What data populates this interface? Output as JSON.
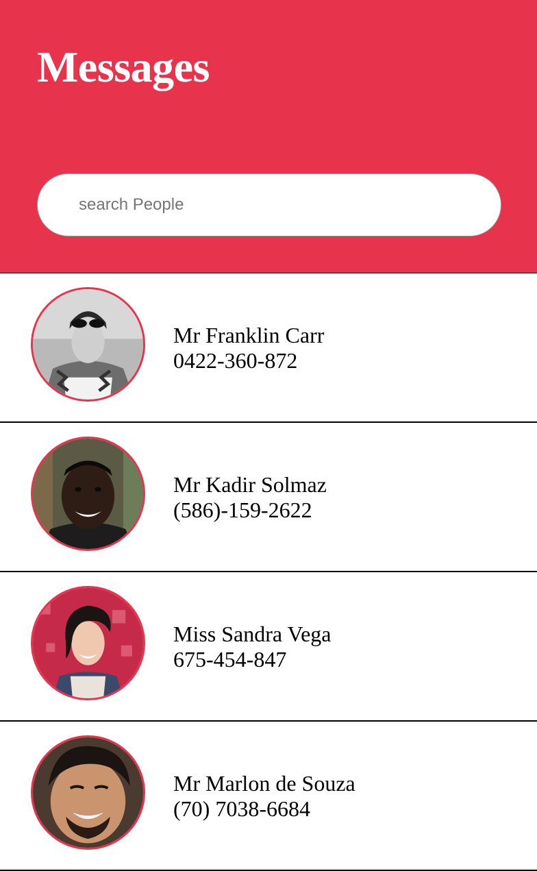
{
  "header": {
    "title": "Messages",
    "background_color": "#e8334d"
  },
  "search": {
    "placeholder": "search People",
    "value": ""
  },
  "contacts": [
    {
      "name": "Mr Franklin Carr",
      "phone": "0422-360-872"
    },
    {
      "name": "Mr Kadir Solmaz",
      "phone": "(586)-159-2622"
    },
    {
      "name": "Miss Sandra Vega",
      "phone": "675-454-847"
    },
    {
      "name": "Mr Marlon de Souza",
      "phone": "(70) 7038-6684"
    }
  ]
}
